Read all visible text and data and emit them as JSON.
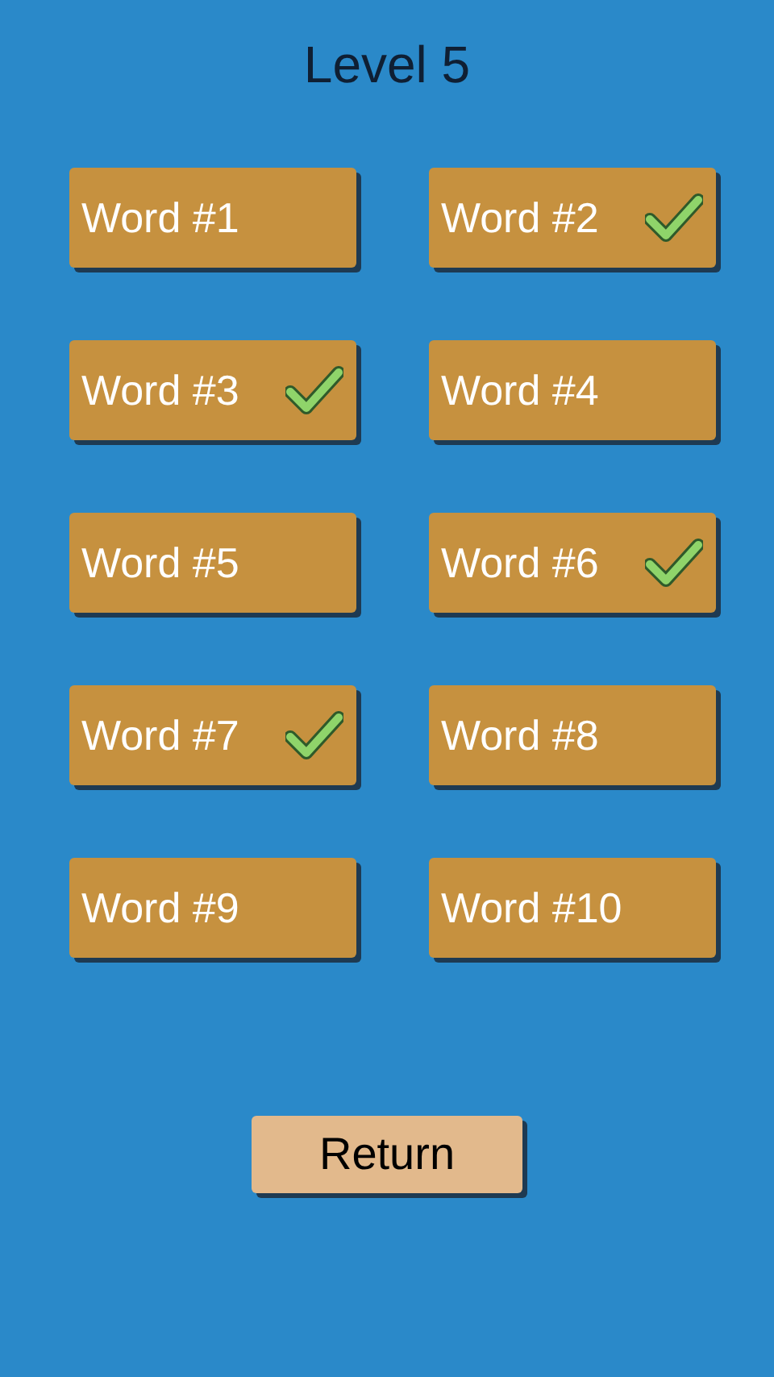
{
  "title": "Level 5",
  "words": [
    {
      "label": "Word #1",
      "checked": false
    },
    {
      "label": "Word #2",
      "checked": true
    },
    {
      "label": "Word #3",
      "checked": true
    },
    {
      "label": "Word #4",
      "checked": false
    },
    {
      "label": "Word #5",
      "checked": false
    },
    {
      "label": "Word #6",
      "checked": true
    },
    {
      "label": "Word #7",
      "checked": true
    },
    {
      "label": "Word #8",
      "checked": false
    },
    {
      "label": "Word #9",
      "checked": false
    },
    {
      "label": "Word #10",
      "checked": false
    }
  ],
  "return_button": "Return"
}
